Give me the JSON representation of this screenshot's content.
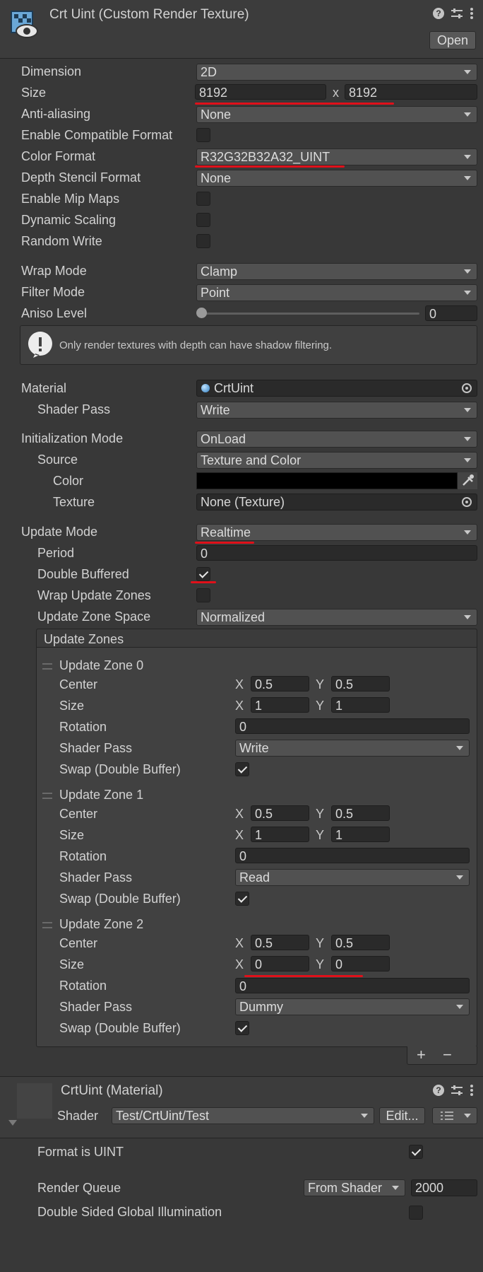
{
  "header": {
    "title": "Crt Uint (Custom Render Texture)",
    "open_label": "Open"
  },
  "texture": {
    "dimension_label": "Dimension",
    "dimension": "2D",
    "size_label": "Size",
    "width": "8192",
    "height": "8192",
    "x_sep": "x",
    "aa_label": "Anti-aliasing",
    "aa": "None",
    "compat_label": "Enable Compatible Format",
    "color_format_label": "Color Format",
    "color_format": "R32G32B32A32_UINT",
    "depth_label": "Depth Stencil Format",
    "depth": "None",
    "mip_label": "Enable Mip Maps",
    "dyn_label": "Dynamic Scaling",
    "rw_label": "Random Write",
    "wrap_label": "Wrap Mode",
    "wrap": "Clamp",
    "filter_label": "Filter Mode",
    "filter": "Point",
    "aniso_label": "Aniso Level",
    "aniso": "0",
    "info": "Only render textures with depth can have shadow filtering.",
    "aniso_fraction": 0
  },
  "material": {
    "material_label": "Material",
    "material": "CrtUint",
    "shader_pass_label": "Shader Pass",
    "shader_pass": "Write"
  },
  "init": {
    "mode_label": "Initialization Mode",
    "mode": "OnLoad",
    "source_label": "Source",
    "source": "Texture and Color",
    "color_label": "Color",
    "texture_label": "Texture",
    "texture": "None (Texture)"
  },
  "update": {
    "mode_label": "Update Mode",
    "mode": "Realtime",
    "period_label": "Period",
    "period": "0",
    "double_label": "Double Buffered",
    "wrap_label": "Wrap Update Zones",
    "space_label": "Update Zone Space",
    "space": "Normalized",
    "zones_title": "Update Zones",
    "zone_fields": {
      "center": "Center",
      "size": "Size",
      "rotation": "Rotation",
      "shader_pass": "Shader Pass",
      "swap": "Swap (Double Buffer)",
      "x": "X",
      "y": "Y"
    },
    "zones": [
      {
        "name": "Update Zone 0",
        "cx": "0.5",
        "cy": "0.5",
        "sx": "1",
        "sy": "1",
        "rotation": "0",
        "pass": "Write"
      },
      {
        "name": "Update Zone 1",
        "cx": "0.5",
        "cy": "0.5",
        "sx": "1",
        "sy": "1",
        "rotation": "0",
        "pass": "Read"
      },
      {
        "name": "Update Zone 2",
        "cx": "0.5",
        "cy": "0.5",
        "sx": "0",
        "sy": "0",
        "rotation": "0",
        "pass": "Dummy"
      }
    ],
    "add_symbol": "+",
    "remove_symbol": "−"
  },
  "mat_inspector": {
    "title": "CrtUint (Material)",
    "shader_label": "Shader",
    "shader": "Test/CrtUint/Test",
    "edit_label": "Edit...",
    "format_uint_label": "Format is UINT",
    "render_queue_label": "Render Queue",
    "render_queue_mode": "From Shader",
    "render_queue": "2000",
    "dsgi_label": "Double Sided Global Illumination"
  },
  "colors": {
    "annotation_red": "#e0101a",
    "panel": "#383838",
    "field": "#2a2a2a"
  }
}
